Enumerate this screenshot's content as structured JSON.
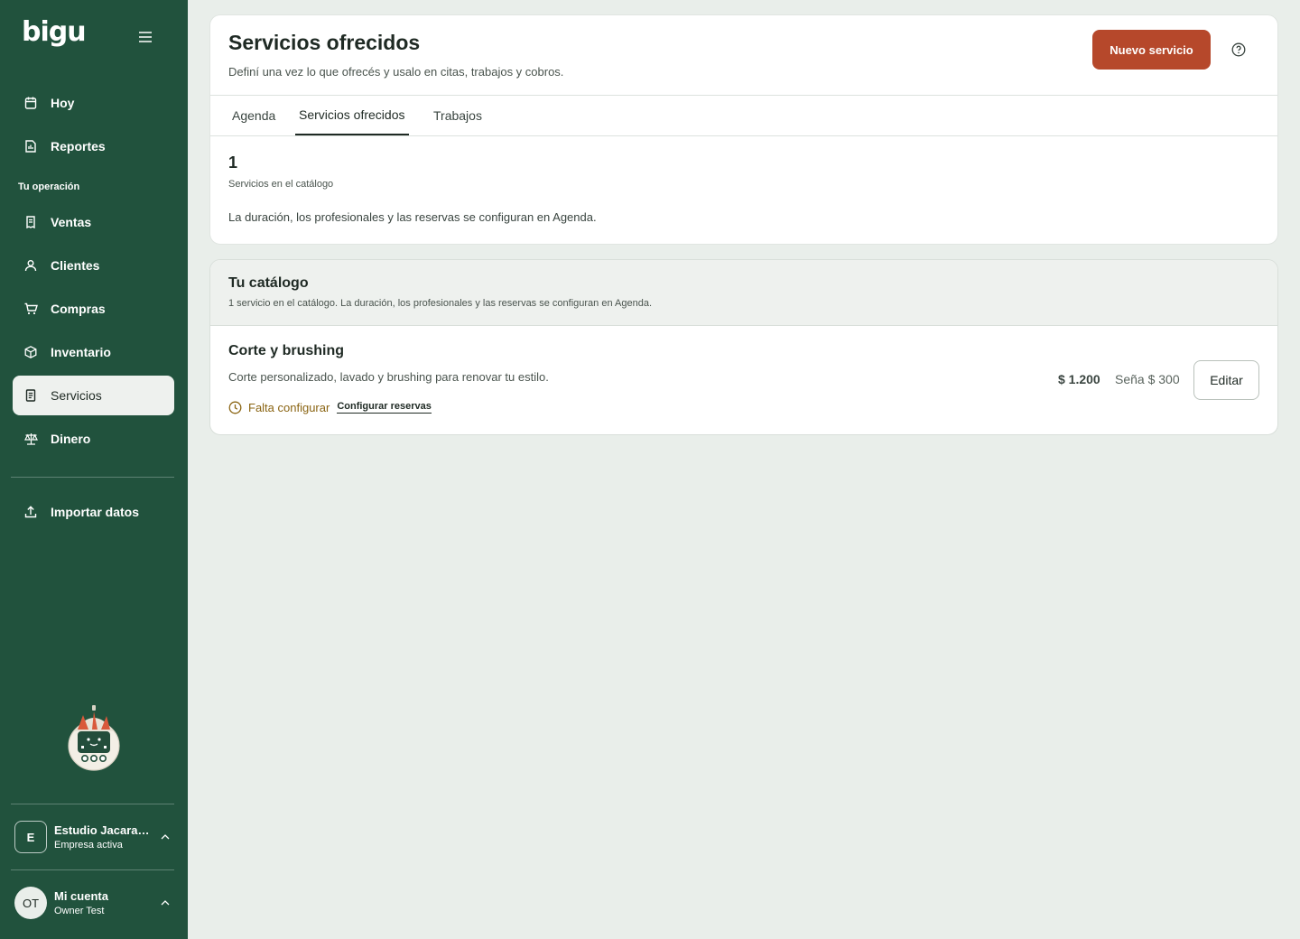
{
  "app": {
    "logo": "bigu"
  },
  "sidebar": {
    "items_top": [
      {
        "label": "Hoy",
        "icon": "calendar-today-icon"
      },
      {
        "label": "Reportes",
        "icon": "report-icon"
      }
    ],
    "section_label": "Tu operación",
    "items_ops": [
      {
        "label": "Ventas",
        "icon": "receipt-icon"
      },
      {
        "label": "Clientes",
        "icon": "user-icon"
      },
      {
        "label": "Compras",
        "icon": "cart-icon"
      },
      {
        "label": "Inventario",
        "icon": "box-icon"
      },
      {
        "label": "Servicios",
        "icon": "document-icon",
        "active": true
      },
      {
        "label": "Dinero",
        "icon": "scale-icon"
      }
    ],
    "import_label": "Importar datos",
    "company": {
      "initial": "E",
      "name": "Estudio Jacaranda",
      "status": "Empresa activa"
    },
    "account": {
      "initials": "OT",
      "name": "Mi cuenta",
      "user": "Owner Test"
    }
  },
  "header": {
    "title": "Servicios ofrecidos",
    "subtitle": "Definí una vez lo que ofrecés y usalo en citas, trabajos y cobros.",
    "new_button": "Nuevo servicio"
  },
  "tabs": [
    {
      "label": "Agenda"
    },
    {
      "label": "Servicios ofrecidos",
      "active": true
    },
    {
      "label": "Trabajos"
    }
  ],
  "stats": {
    "count": "1",
    "count_label": "Servicios en el catálogo",
    "info": "La duración, los profesionales y las reservas se configuran en Agenda."
  },
  "catalog": {
    "title": "Tu catálogo",
    "subtitle": "1 servicio en el catálogo. La duración, los profesionales y las reservas se configuran en Agenda.",
    "services": [
      {
        "name": "Corte y brushing",
        "description": "Corte personalizado, lavado y brushing para renovar tu estilo.",
        "warning": "Falta configurar",
        "link": "Configurar reservas",
        "price": "$ 1.200",
        "deposit": "Seña $ 300",
        "edit_label": "Editar"
      }
    ]
  },
  "colors": {
    "sidebar": "#21523d",
    "accent": "#b6482b",
    "background": "#e9eeea",
    "warning": "#8a6412"
  }
}
